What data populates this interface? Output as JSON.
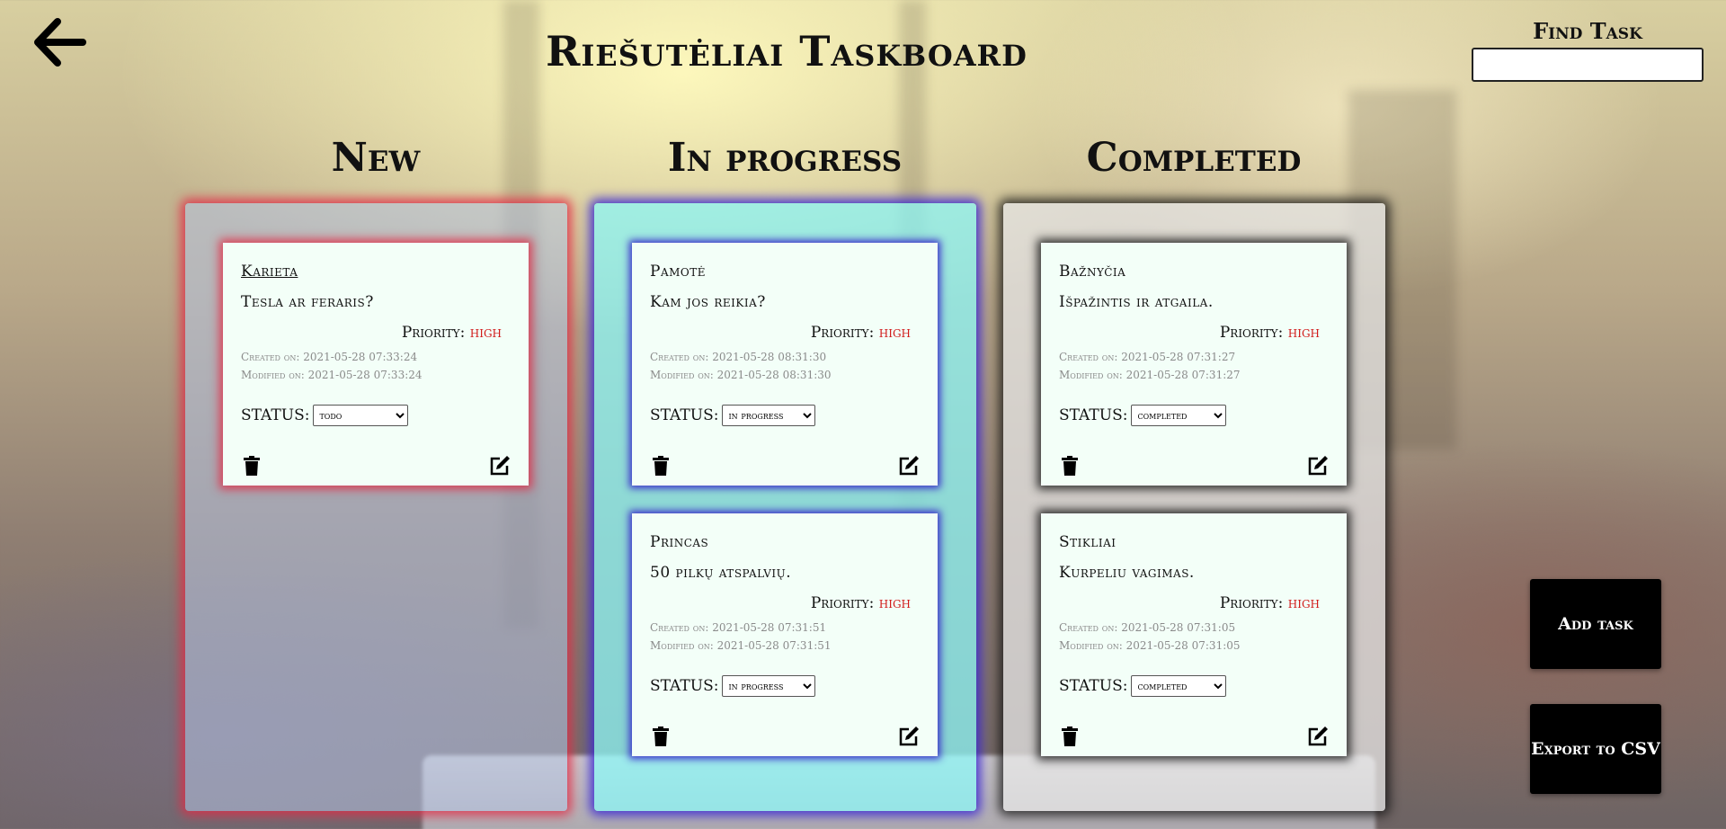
{
  "header": {
    "title": "Riešutėliai Taskboard",
    "find_label": "Find Task",
    "find_value": "",
    "find_placeholder": ""
  },
  "columns": [
    {
      "title": "New",
      "cards": [
        {
          "title": "Karieta",
          "description": "Tesla ar feraris?",
          "priority_label": "Priority:",
          "priority": "high",
          "created": "Created on: 2021-05-28 07:33:24",
          "modified": "Modified on: 2021-05-28 07:33:24",
          "status_label": "STATUS:",
          "status": "todo"
        }
      ]
    },
    {
      "title": "In progress",
      "cards": [
        {
          "title": "Pamotė",
          "description": "Kam jos reikia?",
          "priority_label": "Priority:",
          "priority": "high",
          "created": "Created on: 2021-05-28 08:31:30",
          "modified": "Modified on: 2021-05-28 08:31:30",
          "status_label": "STATUS:",
          "status": "in progress"
        },
        {
          "title": "Princas",
          "description": "50 pilkų atspalvių.",
          "priority_label": "Priority:",
          "priority": "high",
          "created": "Created on: 2021-05-28 07:31:51",
          "modified": "Modified on: 2021-05-28 07:31:51",
          "status_label": "STATUS:",
          "status": "in progress"
        }
      ]
    },
    {
      "title": "Completed",
      "cards": [
        {
          "title": "Bažnyčia",
          "description": "Išpažintis ir atgaila.",
          "priority_label": "Priority:",
          "priority": "high",
          "created": "Created on: 2021-05-28 07:31:27",
          "modified": "Modified on: 2021-05-28 07:31:27",
          "status_label": "STATUS:",
          "status": "completed"
        },
        {
          "title": "Stikliai",
          "description": "Kurpeliu vagimas.",
          "priority_label": "Priority:",
          "priority": "high",
          "created": "Created on: 2021-05-28 07:31:05",
          "modified": "Modified on: 2021-05-28 07:31:05",
          "status_label": "STATUS:",
          "status": "completed"
        }
      ]
    }
  ],
  "actions": {
    "add_task": "Add task",
    "export_csv": "Export to CSV"
  },
  "colors": {
    "new_glow": "#e12d46",
    "progress_glow": "#3c28d2",
    "completed_glow": "#141414",
    "priority_high": "#d11a1a",
    "card_bg": "#f3fff8"
  },
  "icons": {
    "back": "arrow-left-icon",
    "delete": "trash-icon",
    "edit": "edit-icon"
  }
}
